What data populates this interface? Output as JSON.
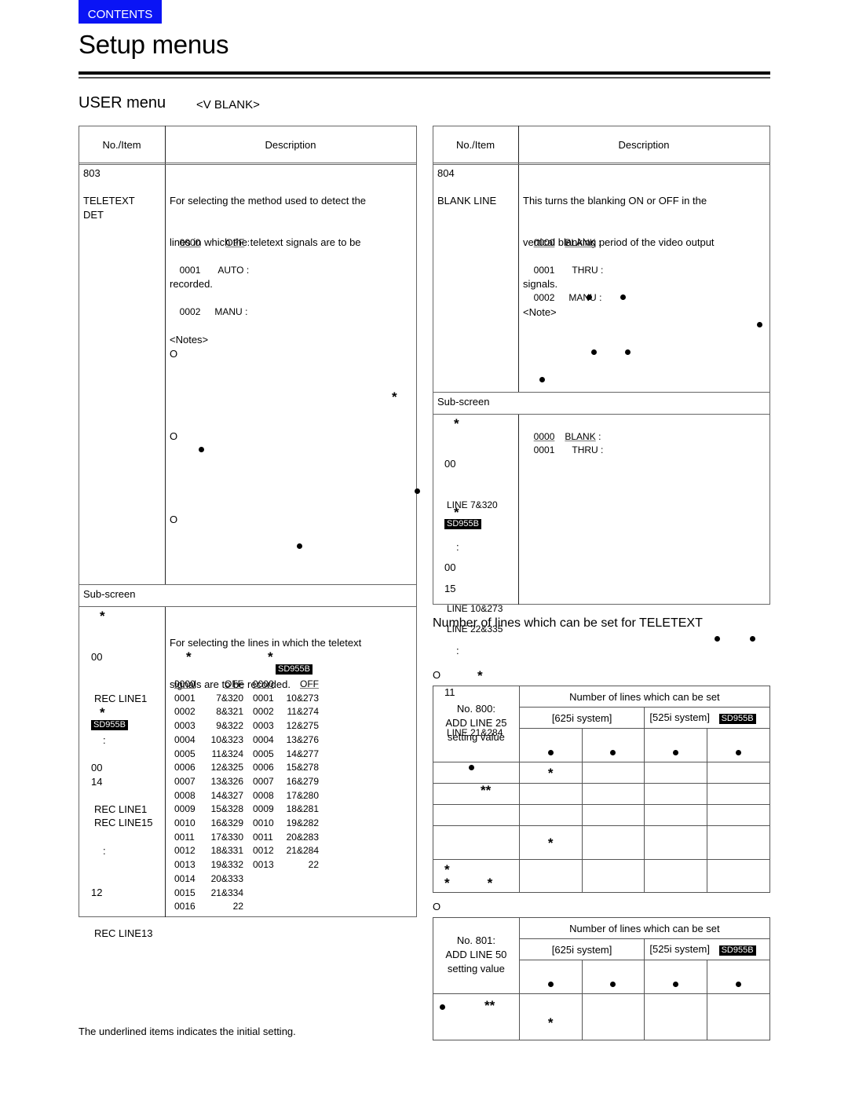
{
  "nav": {
    "contents_label": "CONTENTS",
    "accent_color": "#0a14f5"
  },
  "page": {
    "title": "Setup menus"
  },
  "section": {
    "title": "USER menu",
    "subtitle": "<V BLANK>"
  },
  "left_table": {
    "header": {
      "item": "No./Item",
      "description": "Description"
    },
    "item_803": {
      "number": "803",
      "name_line1": "TELETEXT",
      "name_line2": "DET",
      "description_lines": [
        "For selecting the method used to detect the",
        "lines in which the teletext signals are to be",
        "recorded."
      ],
      "options": [
        {
          "code": "0000",
          "label": "OFF",
          "suffix": ":",
          "initial": true
        },
        {
          "code": "0001",
          "label": "AUTO",
          "suffix": ":",
          "initial": false
        },
        {
          "code": "0002",
          "label": "MANU",
          "suffix": ":",
          "initial": false
        }
      ],
      "notes_label": "<Notes>",
      "note_markers": [
        "O",
        "O",
        "O"
      ]
    },
    "subscreen_label": "Sub-screen",
    "subscreen": {
      "left": {
        "star": "*",
        "range1": {
          "start": "00",
          "start_label": "REC LINE1",
          "ellipsis": ":",
          "end": "14",
          "end_label": "REC LINE15"
        },
        "badge": "SD955B",
        "range2": {
          "start": "00",
          "start_label": "REC LINE1",
          "ellipsis": ":",
          "end": "12",
          "end_label": "REC LINE13"
        }
      },
      "description_lines": [
        "For selecting the lines in which the teletext",
        "signals are to be recorded."
      ],
      "badge": "SD955B",
      "col_625": [
        [
          "0000",
          "OFF"
        ],
        [
          "0001",
          "7&320"
        ],
        [
          "0002",
          "8&321"
        ],
        [
          "0003",
          "9&322"
        ],
        [
          "0004",
          "10&323"
        ],
        [
          "0005",
          "11&324"
        ],
        [
          "0006",
          "12&325"
        ],
        [
          "0007",
          "13&326"
        ],
        [
          "0008",
          "14&327"
        ],
        [
          "0009",
          "15&328"
        ],
        [
          "0010",
          "16&329"
        ],
        [
          "0011",
          "17&330"
        ],
        [
          "0012",
          "18&331"
        ],
        [
          "0013",
          "19&332"
        ],
        [
          "0014",
          "20&333"
        ],
        [
          "0015",
          "21&334"
        ],
        [
          "0016",
          "22"
        ]
      ],
      "col_525": [
        [
          "0000",
          "OFF"
        ],
        [
          "0001",
          "10&273"
        ],
        [
          "0002",
          "11&274"
        ],
        [
          "0003",
          "12&275"
        ],
        [
          "0004",
          "13&276"
        ],
        [
          "0005",
          "14&277"
        ],
        [
          "0006",
          "15&278"
        ],
        [
          "0007",
          "16&279"
        ],
        [
          "0008",
          "17&280"
        ],
        [
          "0009",
          "18&281"
        ],
        [
          "0010",
          "19&282"
        ],
        [
          "0011",
          "20&283"
        ],
        [
          "0012",
          "21&284"
        ],
        [
          "0013",
          "22"
        ]
      ]
    }
  },
  "right_table": {
    "header": {
      "item": "No./Item",
      "description": "Description"
    },
    "item_804": {
      "number": "804",
      "name": "BLANK LINE",
      "description_lines": [
        "This turns the blanking ON or OFF in the",
        "vertical blanking period of the video output",
        "signals."
      ],
      "options": [
        {
          "code": "0000",
          "label": "BLANK",
          "suffix": ":",
          "initial": true
        },
        {
          "code": "0001",
          "label": "THRU",
          "suffix": ":",
          "initial": false
        },
        {
          "code": "0002",
          "label": "MANU",
          "suffix": ":",
          "initial": false
        }
      ],
      "note_label": "<Note>"
    },
    "subscreen_label": "Sub-screen",
    "subscreen": {
      "left": {
        "star": "*",
        "range1": {
          "start": "00",
          "start_label": "LINE 7&320",
          "ellipsis": ":",
          "end": "15",
          "end_label": "LINE 22&335"
        },
        "badge": "SD955B",
        "range2": {
          "start": "00",
          "start_label": "LINE 10&273",
          "ellipsis": ":",
          "end": "11",
          "end_label": "LINE 21&284"
        }
      },
      "options": [
        {
          "code": "0000",
          "label": "BLANK",
          "suffix": ":",
          "initial": true
        },
        {
          "code": "0001",
          "label": "THRU",
          "suffix": ":",
          "initial": false
        }
      ]
    }
  },
  "teletext_section": {
    "title": "Number of lines which can be set for TELETEXT",
    "marker": "O",
    "star": "*",
    "table_800": {
      "row_label": [
        "No. 800:",
        "ADD LINE 25",
        "setting value"
      ],
      "group_header": "Number of lines which can be set",
      "system_625": "[625i system]",
      "system_525": "[525i system]",
      "badge": "SD955B"
    },
    "marker2": "O",
    "table_801": {
      "row_label": [
        "No. 801:",
        "ADD LINE 50",
        "setting value"
      ],
      "group_header": "Number of lines which can be set",
      "system_625": "[625i system]",
      "system_525": "[525i system]",
      "badge": "SD955B"
    }
  },
  "footer": {
    "note": "The underlined items indicates the initial setting."
  }
}
